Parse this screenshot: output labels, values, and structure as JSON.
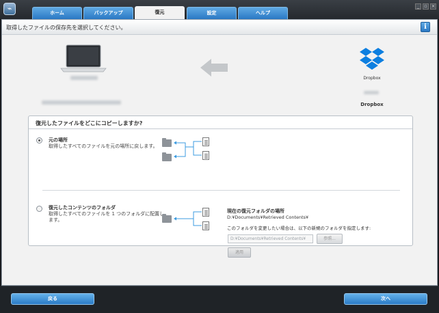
{
  "tabs": [
    {
      "label": "ホーム"
    },
    {
      "label": "バックアップ"
    },
    {
      "label": "復元"
    },
    {
      "label": "設定"
    },
    {
      "label": "ヘルプ"
    }
  ],
  "active_tab": "復元",
  "header": {
    "instruction": "取得したファイルの保存先を選択してください。",
    "info_icon": "i"
  },
  "destination": {
    "caption": "Dropbox",
    "label": "Dropbox"
  },
  "options_group": {
    "title": "復元したファイルをどこにコピーしますか?",
    "original": {
      "title": "元の場所",
      "description": "取得したすべてのファイルを元の場所に戻します。",
      "selected": true
    },
    "folder": {
      "title": "復元したコンテンツのフォルダ",
      "description_line1": "取得したすべてのファイルを 1 つのフォルダに配置し",
      "description_line2": "ます。",
      "selected": false,
      "current_title": "現在の復元フォルダの場所",
      "current_path": "D:¥Documents¥Retrieved Contents¥",
      "change_note": "このフォルダを変更したい場合は、以下の新規のフォルダを指定します:",
      "input_value": "D:¥Documents¥Retrieved Contents¥",
      "browse_label": "参照...",
      "apply_label": "適用"
    }
  },
  "footer": {
    "back_label": "戻る",
    "next_label": "次へ"
  },
  "colors": {
    "accent": "#2a78c4",
    "frame": "#1f2327",
    "dropbox": "#0d7fe0"
  }
}
